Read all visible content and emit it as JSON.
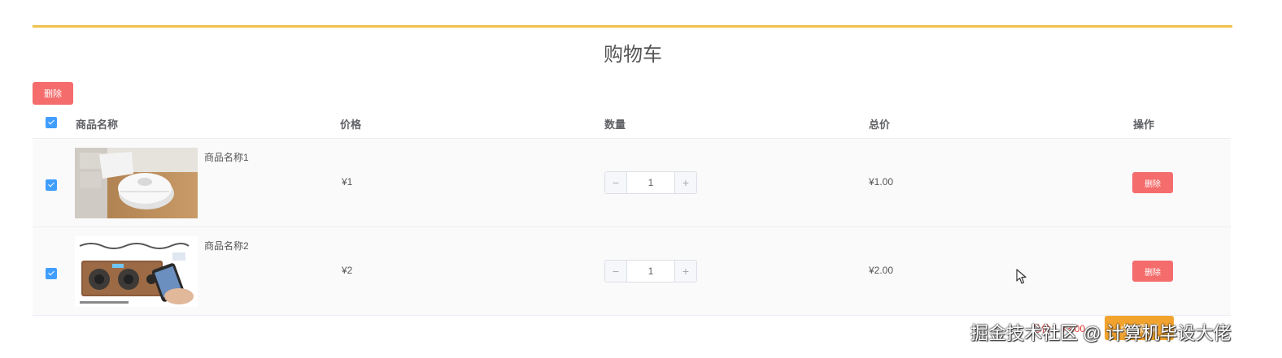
{
  "page": {
    "title": "购物车"
  },
  "toolbar": {
    "delete_label": "删除"
  },
  "table": {
    "headers": {
      "name": "商品名称",
      "price": "价格",
      "quantity": "数量",
      "total": "总价",
      "actions": "操作"
    },
    "rows": [
      {
        "checked": true,
        "name": "商品名称1",
        "price": "¥1",
        "quantity": "1",
        "total": "¥1.00",
        "delete_label": "删除"
      },
      {
        "checked": true,
        "name": "商品名称2",
        "price": "¥2",
        "quantity": "1",
        "total": "¥2.00",
        "delete_label": "删除"
      }
    ]
  },
  "footer": {
    "total_label": "总价：",
    "total_value": "¥3.00",
    "checkout_label": "点击购买"
  },
  "watermark": "掘金技术社区 @ 计算机毕设大佬",
  "colors": {
    "accent_line": "#f0c24b",
    "danger": "#f56c6c",
    "checkbox": "#409eff",
    "checkout": "#f2a32e"
  }
}
